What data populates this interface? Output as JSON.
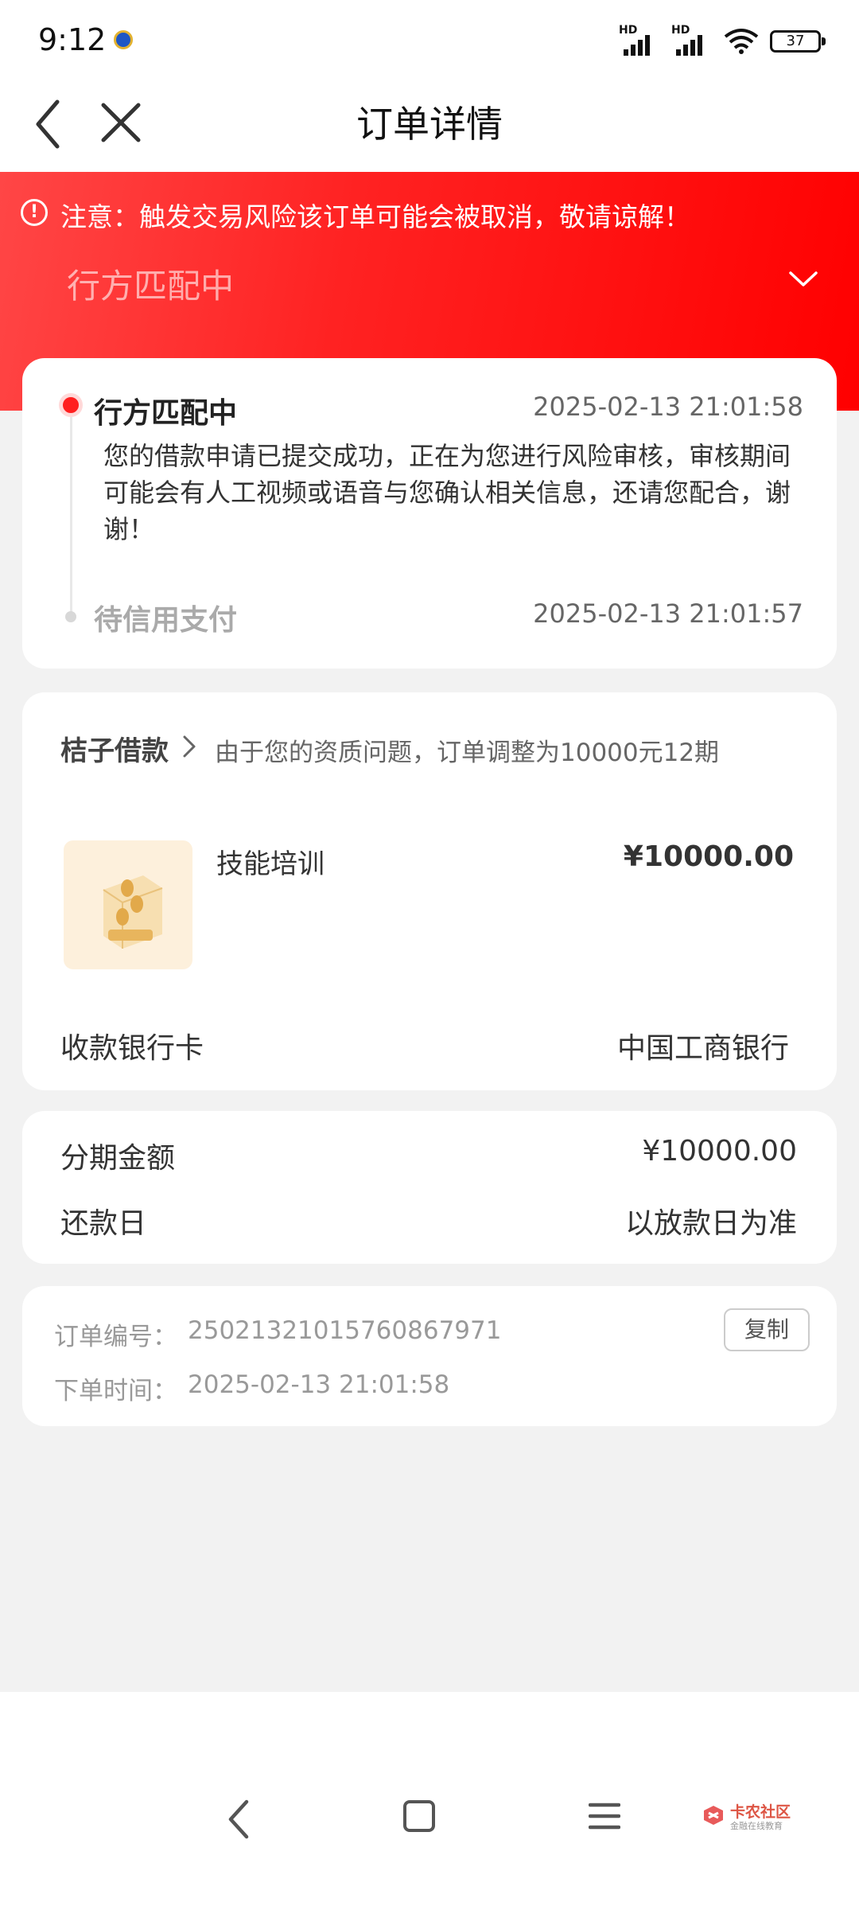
{
  "status_bar": {
    "time": "9:12",
    "network_1": "HD",
    "network_2": "HD",
    "battery": "37"
  },
  "header": {
    "title": "订单详情"
  },
  "banner": {
    "warning": "注意：触发交易风险该订单可能会被取消，敬请谅解！",
    "status": "行方匹配中"
  },
  "timeline": [
    {
      "title": "行方匹配中",
      "time": "2025-02-13 21:01:58",
      "desc": "您的借款申请已提交成功，正在为您进行风险审核，审核期间可能会有人工视频或语音与您确认相关信息，还请您配合，谢谢！"
    },
    {
      "title": "待信用支付",
      "time": "2025-02-13 21:01:57"
    }
  ],
  "product": {
    "brand": "桔子借款",
    "note": "由于您的资质问题，订单调整为10000元12期",
    "name": "技能培训",
    "price": "¥10000.00",
    "bank_label": "收款银行卡",
    "bank_value": "中国工商银行"
  },
  "installment": {
    "amount_label": "分期金额",
    "amount_value": "¥10000.00",
    "repay_label": "还款日",
    "repay_value": "以放款日为准"
  },
  "order_info": {
    "number_label": "订单编号：",
    "number_value": "250213210157608679​71",
    "copy_label": "复制",
    "time_label": "下单时间：",
    "time_value": "2025-02-13 21:01:58"
  },
  "watermark": {
    "name": "卡农社区",
    "sub": "金融在线教育"
  },
  "colors": {
    "accent": "#ff1f1f",
    "background": "#f2f2f2"
  },
  "icons": [
    "back-icon",
    "close-icon",
    "warning-icon",
    "chevron-down-icon",
    "chevron-right-icon",
    "coin-box-icon"
  ]
}
